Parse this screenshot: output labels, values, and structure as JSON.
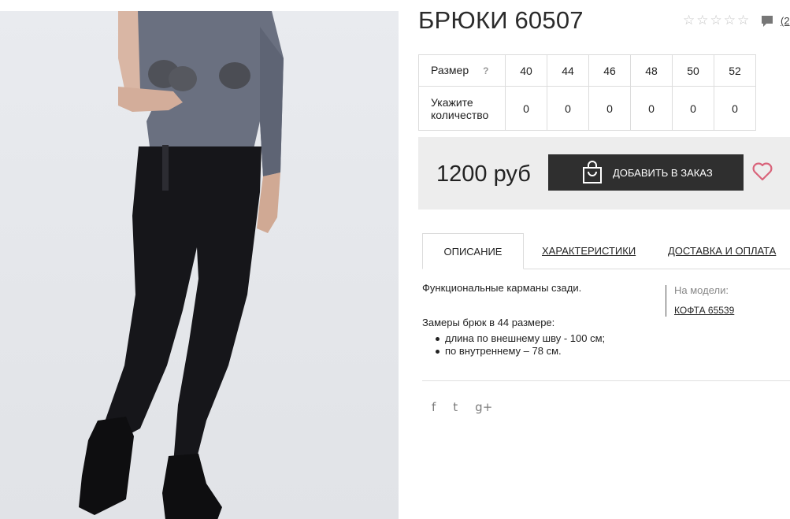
{
  "product": {
    "title": "БРЮКИ 60507",
    "review_count": "(2",
    "rating_stars": 0
  },
  "size_table": {
    "size_label": "Размер",
    "help_mark": "?",
    "sizes": [
      "40",
      "44",
      "46",
      "48",
      "50",
      "52"
    ],
    "qty_label_line1": "Укажите",
    "qty_label_line2": "количество",
    "quantities": [
      "0",
      "0",
      "0",
      "0",
      "0",
      "0"
    ]
  },
  "buy": {
    "price": "1200 руб",
    "add_button": "ДОБАВИТЬ В ЗАКАЗ"
  },
  "tabs": [
    {
      "label": "ОПИСАНИЕ",
      "active": true
    },
    {
      "label": "ХАРАКТЕРИСТИКИ",
      "active": false
    },
    {
      "label": "ДОСТАВКА И ОПЛАТА",
      "active": false
    }
  ],
  "description": {
    "line1": "Функциональные карманы сзади.",
    "measure_title": "Замеры брюк в 44 размере:",
    "bullets": [
      "длина по внешнему шву - 100 см;",
      "по внутреннему – 78 см."
    ]
  },
  "model": {
    "label": "На модели:",
    "link": "КОФТА 65539"
  },
  "share": {
    "facebook": "f",
    "twitter": "t",
    "google": "g+"
  },
  "icons": {
    "star": "star-outline-icon",
    "comment": "comment-icon",
    "bag": "shopping-bag-icon",
    "heart": "heart-icon"
  },
  "colors": {
    "button_bg": "#2f2f2f",
    "heart": "#d9637a",
    "buybox_bg": "#ededed"
  }
}
